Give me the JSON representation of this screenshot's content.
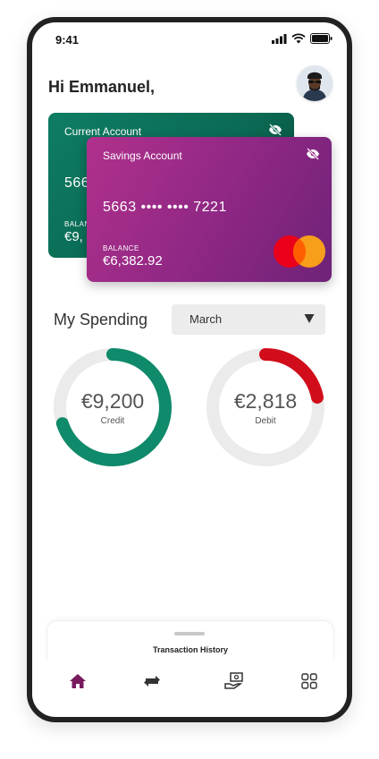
{
  "status_bar": {
    "time": "9:41"
  },
  "greeting": "Hi Emmanuel,",
  "cards": {
    "current": {
      "name": "Current Account",
      "number_partial": "566",
      "balance_label": "BALANCE",
      "balance_partial": "€9,"
    },
    "savings": {
      "name": "Savings Account",
      "number": "5663 •••• •••• 7221",
      "balance_label": "BALANCE",
      "balance": "€6,382.92"
    }
  },
  "spending": {
    "title": "My Spending",
    "month_selected": "March",
    "credit": {
      "amount": "€9,200",
      "label": "Credit",
      "fraction": 0.7,
      "color": "#0f8a6a"
    },
    "debit": {
      "amount": "€2,818",
      "label": "Debit",
      "fraction": 0.22,
      "color": "#d10d1b"
    }
  },
  "transactions": {
    "title": "Transaction History"
  },
  "nav": {
    "icons": [
      "home-icon",
      "transfer-icon",
      "payments-icon",
      "menu-grid-icon"
    ],
    "active_color": "#7a1b5e"
  },
  "colors": {
    "current_card": "#0e7d63",
    "savings_card": "#9a2a88",
    "track": "#ebebeb"
  }
}
